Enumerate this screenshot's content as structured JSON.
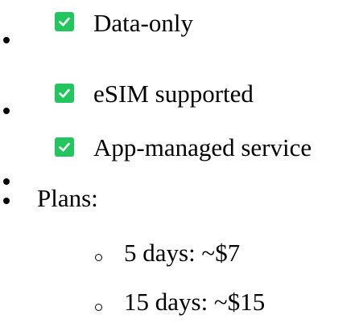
{
  "colors": {
    "check_green": "#22c55e",
    "check_mark": "#ffffff",
    "text": "#000000"
  },
  "features": [
    {
      "icon": "check-mark-button-icon",
      "text": "Data-only"
    },
    {
      "icon": "check-mark-button-icon",
      "text": "eSIM supported"
    },
    {
      "icon": "check-mark-button-icon",
      "text": "App-managed service"
    }
  ],
  "plans": {
    "heading": "Plans:",
    "items": [
      {
        "text": "5 days: ~$7"
      },
      {
        "text": "15 days: ~$15"
      }
    ]
  }
}
